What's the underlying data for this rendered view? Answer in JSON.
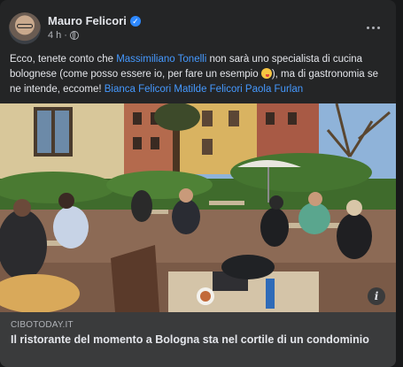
{
  "post": {
    "author": "Mauro Felicori",
    "timestamp": "4 h",
    "separator": "·",
    "verified_icon": "verified-badge-icon",
    "text_parts": {
      "p1": "Ecco, tenete conto che ",
      "tag1": "Massimiliano Tonelli",
      "p2": " non sarà uno specialista di cucina bolognese (come posso essere io, per fare un esempio ",
      "p3": "), ma di gastronomia se ne intende, eccome! ",
      "tag2": "Bianca Felicori",
      "tag3": "Matilde Felicori",
      "tag4": "Paola Furlan"
    },
    "emoji_name": "zany-face-emoji"
  },
  "link": {
    "domain": "CIBOTODAY.IT",
    "title": "Il ristorante del momento a Bologna sta nel cortile di un condominio"
  },
  "colors": {
    "background": "#18191a",
    "card": "#242526",
    "link_bg": "#3a3b3c",
    "text_primary": "#e4e6eb",
    "text_secondary": "#b0b3b8",
    "accent": "#4599ff"
  },
  "icons": {
    "globe": "globe-icon",
    "more": "more-options-icon",
    "info": "info-icon"
  }
}
